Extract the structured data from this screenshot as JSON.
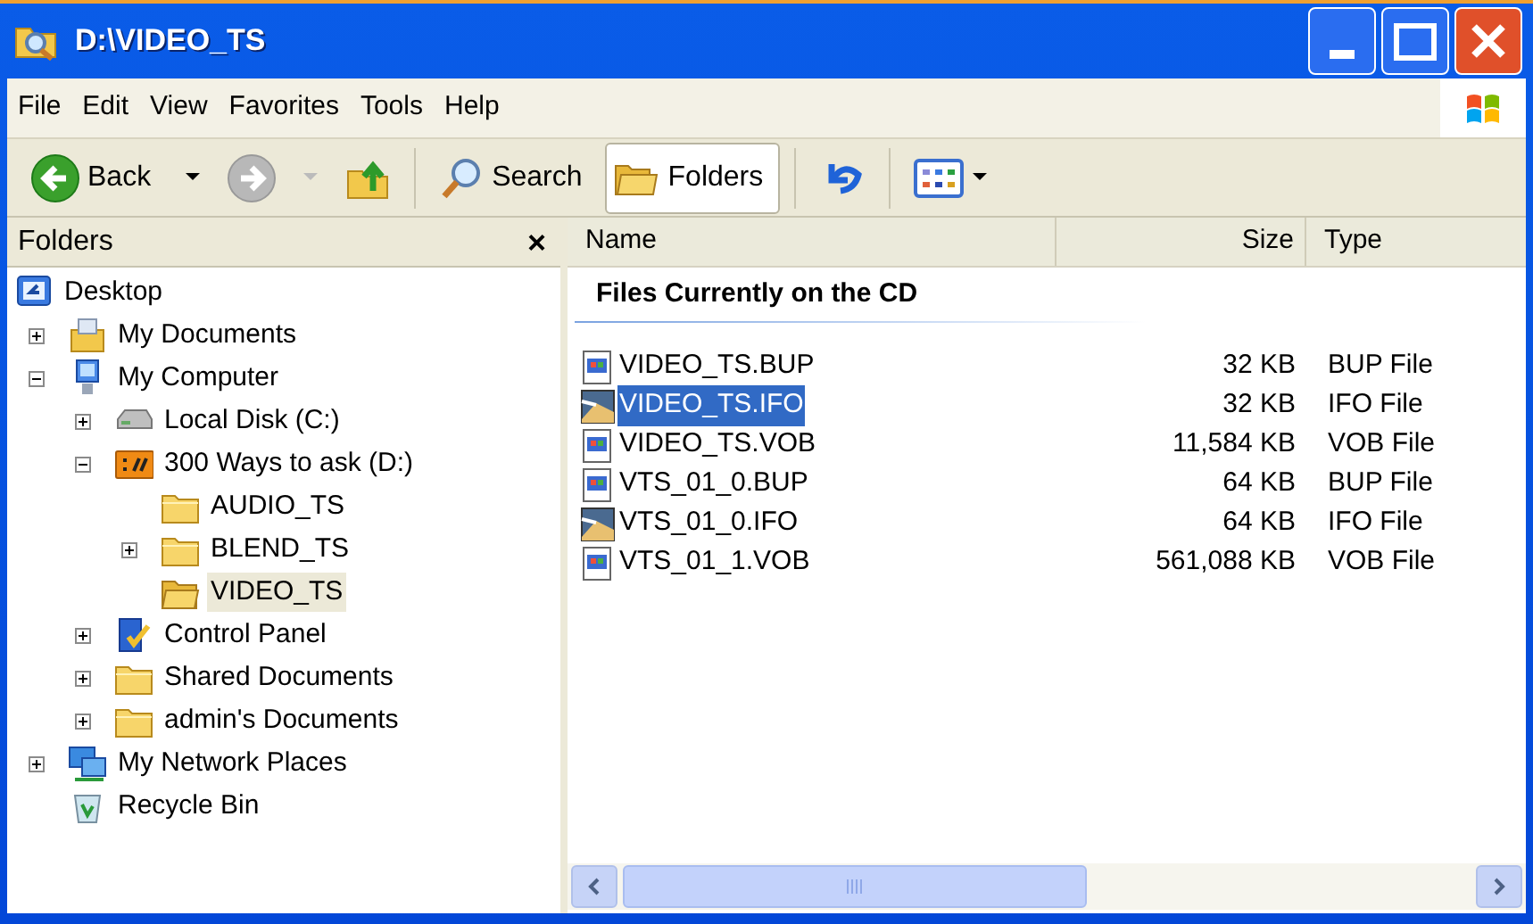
{
  "window": {
    "title": "D:\\VIDEO_TS"
  },
  "menu": [
    "File",
    "Edit",
    "View",
    "Favorites",
    "Tools",
    "Help"
  ],
  "toolbar": [
    {
      "kind": "back",
      "label": "Back"
    },
    {
      "kind": "forward"
    },
    {
      "kind": "up"
    },
    {
      "kind": "search",
      "label": "Search",
      "pressed": false
    },
    {
      "kind": "folders",
      "label": "Folders",
      "pressed": true
    },
    {
      "kind": "undo"
    },
    {
      "kind": "views"
    }
  ],
  "folders_pane": {
    "title": "Folders",
    "close": "×",
    "tree": [
      {
        "label": "Desktop",
        "kind": "desktop",
        "selected": false,
        "children": [
          {
            "label": "My Documents",
            "kind": "documents",
            "expanded": false,
            "selected": false
          },
          {
            "label": "My Computer",
            "kind": "computer",
            "expanded": true,
            "selected": false,
            "children": [
              {
                "label": "Local Disk (C:)",
                "kind": "disk",
                "expanded": false,
                "selected": false
              },
              {
                "label": "300 Ways to ask (D:)",
                "kind": "cd",
                "expanded": true,
                "selected": false,
                "children": [
                  {
                    "label": "AUDIO_TS",
                    "kind": "folder",
                    "selected": false
                  },
                  {
                    "label": "BLEND_TS",
                    "kind": "folder",
                    "expanded": false,
                    "selected": false
                  },
                  {
                    "label": "VIDEO_TS",
                    "kind": "openfolder",
                    "selected": true
                  }
                ]
              },
              {
                "label": "Control Panel",
                "kind": "control",
                "expanded": false,
                "selected": false
              },
              {
                "label": "Shared Documents",
                "kind": "folder",
                "expanded": false,
                "selected": false
              },
              {
                "label": "admin's Documents",
                "kind": "folder",
                "expanded": false,
                "selected": false
              }
            ]
          },
          {
            "label": "My Network Places",
            "kind": "network",
            "expanded": false,
            "selected": false
          },
          {
            "label": "Recycle Bin",
            "kind": "recycle",
            "selected": false
          }
        ]
      }
    ]
  },
  "file_list": {
    "columns": [
      "Name",
      "Size",
      "Type"
    ],
    "group": "Files Currently on the CD",
    "rows": [
      {
        "name": "VIDEO_TS.BUP",
        "size": "32 KB",
        "type": "BUP File",
        "kind": "media",
        "selected": false
      },
      {
        "name": "VIDEO_TS.IFO",
        "size": "32 KB",
        "type": "IFO File",
        "kind": "image",
        "selected": true
      },
      {
        "name": "VIDEO_TS.VOB",
        "size": "11,584 KB",
        "type": "VOB File",
        "kind": "media",
        "selected": false
      },
      {
        "name": "VTS_01_0.BUP",
        "size": "64 KB",
        "type": "BUP File",
        "kind": "media",
        "selected": false
      },
      {
        "name": "VTS_01_0.IFO",
        "size": "64 KB",
        "type": "IFO File",
        "kind": "image",
        "selected": false
      },
      {
        "name": "VTS_01_1.VOB",
        "size": "561,088 KB",
        "type": "VOB File",
        "kind": "media",
        "selected": false
      }
    ]
  }
}
